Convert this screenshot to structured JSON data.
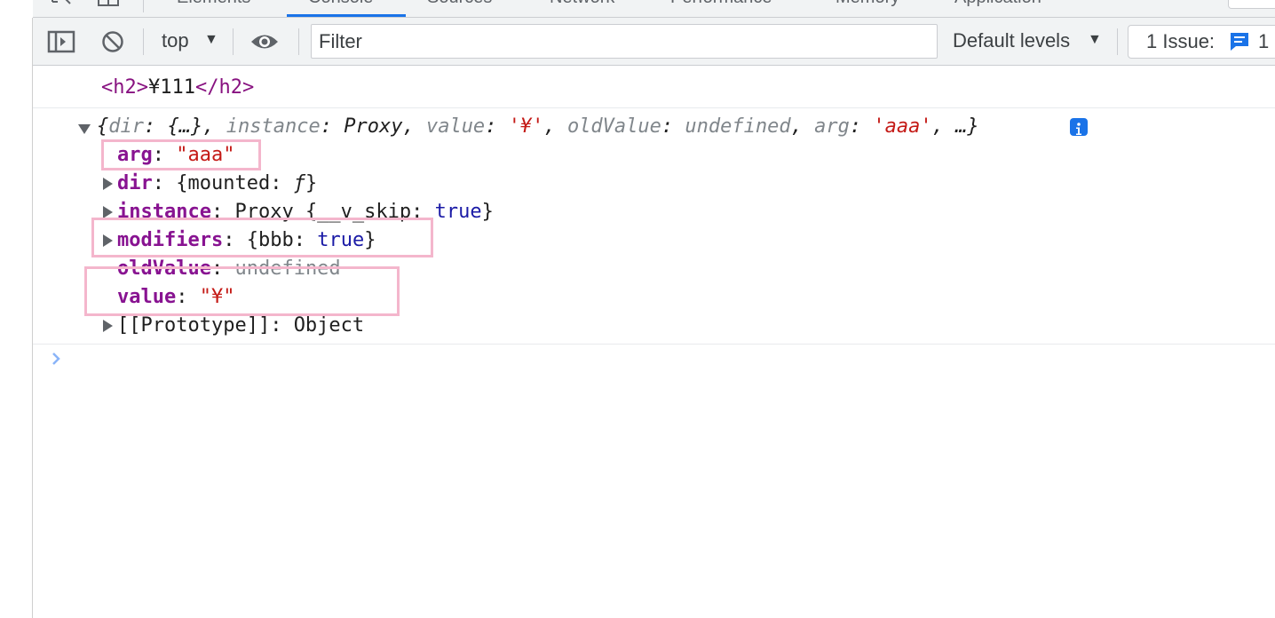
{
  "devtools": {
    "tabs": [
      "Elements",
      "Console",
      "Sources",
      "Network",
      "Performance",
      "Memory",
      "Application"
    ],
    "active_tab": "Console"
  },
  "toolbar": {
    "context": "top",
    "filter_placeholder": "Filter",
    "levels": "Default levels",
    "issues_label": "1 Issue:",
    "issues_count": "1"
  },
  "console": {
    "h2_open": "<h2>",
    "h2_text": "¥111",
    "h2_close": "</h2>",
    "summary": {
      "open": "{",
      "k_dir": "dir",
      "v_dir": "{…}",
      "k_instance": "instance",
      "v_instance": "Proxy",
      "k_value": "value",
      "v_value": "'¥'",
      "k_oldValue": "oldValue",
      "v_oldValue": "undefined",
      "k_arg": "arg",
      "v_arg": "'aaa'",
      "close": "…}"
    },
    "props": [
      {
        "key": "arg",
        "value": "\"aaa\""
      },
      {
        "key": "dir",
        "value_open": "{mounted: ",
        "value_fn": "ƒ",
        "value_close": "}"
      },
      {
        "key": "instance",
        "value_pre": "Proxy {__v_skip: ",
        "value_kw": "true",
        "value_close": "}"
      },
      {
        "key": "modifiers",
        "value_pre": "{bbb: ",
        "value_kw": "true",
        "value_close": "}"
      },
      {
        "key": "oldValue",
        "value": "undefined"
      },
      {
        "key": "value",
        "value": "\"¥\""
      },
      {
        "key": "[[Prototype]]",
        "value": "Object"
      }
    ]
  },
  "colors": {
    "highlight_box": "#f4b6cc",
    "accent": "#1a73e8"
  }
}
